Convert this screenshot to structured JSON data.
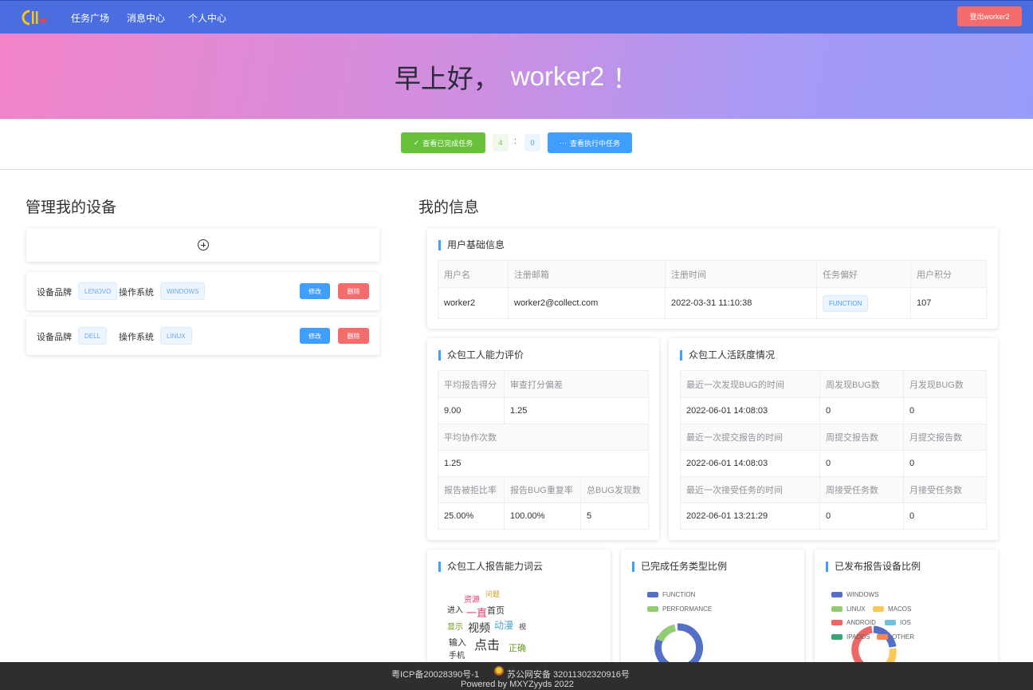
{
  "nav": {
    "logo_text": "CII",
    "items": [
      "任务广场",
      "消息中心",
      "个人中心"
    ],
    "logout": "登出worker2"
  },
  "hero": {
    "greeting": "早上好，",
    "name": "worker2",
    "exclaim": "！"
  },
  "actions": {
    "done_button": "查看已完成任务",
    "done_count": "4",
    "separator": ":",
    "doing_count": "0",
    "doing_button": "查看执行中任务"
  },
  "devices": {
    "title": "管理我的设备",
    "brand_label": "设备品牌",
    "os_label": "操作系统",
    "edit": "修改",
    "delete": "删除",
    "items": [
      {
        "brand": "LENOVO",
        "os": "WINDOWS"
      },
      {
        "brand": "DELL",
        "os": "LINUX"
      }
    ]
  },
  "info": {
    "title": "我的信息",
    "basic": {
      "title": "用户基础信息",
      "headers": [
        "用户名",
        "注册邮箱",
        "注册时间",
        "任务偏好",
        "用户积分"
      ],
      "values": [
        "worker2",
        "worker2@collect.com",
        "2022-03-31 11:10:38",
        "FUNCTION",
        "107"
      ]
    },
    "ability": {
      "title": "众包工人能力评价",
      "avg_score_label": "平均报告得分",
      "avg_score": "9.00",
      "bias_label": "审查打分偏差",
      "bias": "1.25",
      "coop_label": "平均协作次数",
      "coop": "1.25",
      "reject_label": "报告被拒比率",
      "reject": "25.00%",
      "dup_label": "报告BUG重复率",
      "dup": "100.00%",
      "total_label": "总BUG发现数",
      "total": "5"
    },
    "activity": {
      "title": "众包工人活跃度情况",
      "rows": [
        {
          "h": [
            "最近一次发现BUG的时间",
            "周发现BUG数",
            "月发现BUG数"
          ],
          "v": [
            "2022-06-01 14:08:03",
            "0",
            "0"
          ]
        },
        {
          "h": [
            "最近一次提交报告的时间",
            "周提交报告数",
            "月提交报告数"
          ],
          "v": [
            "2022-06-01 14:08:03",
            "0",
            "0"
          ]
        },
        {
          "h": [
            "最近一次接受任务的时间",
            "周接受任务数",
            "月接受任务数"
          ],
          "v": [
            "2022-06-01 13:21:29",
            "0",
            "0"
          ]
        }
      ]
    },
    "wordcloud": {
      "title": "众包工人报告能力词云",
      "words": [
        "问题",
        "资源",
        "进入",
        "一直",
        "首页",
        "显示",
        "视频",
        "动漫",
        "视",
        "输入",
        "点击",
        "正确",
        "手机"
      ]
    },
    "task_types": {
      "title": "已完成任务类型比例",
      "legend": [
        {
          "name": "FUNCTION",
          "color": "#5470c6"
        },
        {
          "name": "PERFORMANCE",
          "color": "#91cc75"
        }
      ]
    },
    "device_ratio": {
      "title": "已发布报告设备比例",
      "legend": [
        {
          "name": "WINDOWS",
          "color": "#5470c6"
        },
        {
          "name": "LINUX",
          "color": "#91cc75"
        },
        {
          "name": "MACOS",
          "color": "#fac858"
        },
        {
          "name": "ANDROID",
          "color": "#ee6666"
        },
        {
          "name": "IOS",
          "color": "#73c0de"
        },
        {
          "name": "IPADOS",
          "color": "#3ba272"
        },
        {
          "name": "OTHER",
          "color": "#fc8452"
        }
      ]
    }
  },
  "footer": {
    "icp": "粤ICP备20028390号-1",
    "police": "苏公网安备 32011302320916号",
    "powered": "Powered by MXYZyyds 2022"
  }
}
